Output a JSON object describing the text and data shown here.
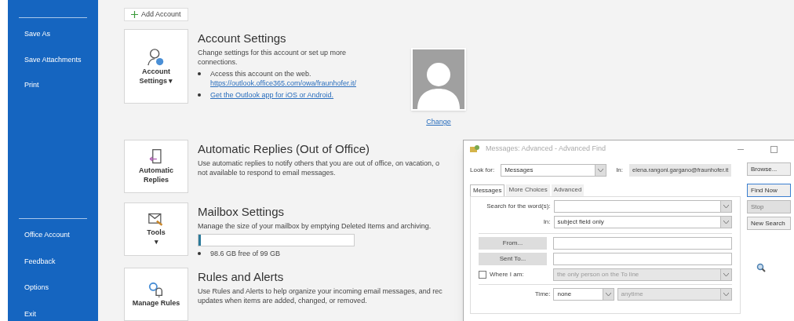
{
  "sidebar": {
    "top_items": [
      "Save As",
      "Save Attachments",
      "Print"
    ],
    "bottom_items": [
      "Office Account",
      "Feedback",
      "Options",
      "Exit"
    ]
  },
  "add_account": "Add Account",
  "sections": [
    {
      "kind": "account",
      "button": [
        "Account",
        "Settings ▾"
      ],
      "title": "Account Settings",
      "description": "Change settings for this account or set up more connections.",
      "bullets": [
        {
          "text": "Access this account on the web.",
          "link": "https://outlook.office365.com/owa/fraunhofer.it/"
        },
        {
          "link": "Get the Outlook app for iOS or Android."
        }
      ],
      "photo_link": "Change"
    },
    {
      "kind": "replies",
      "button": [
        "Automatic",
        "Replies"
      ],
      "title": "Automatic Replies (Out of Office)",
      "description": "Use automatic replies to notify others that you are out of office, on vacation, o",
      "description_2": "not available to respond to email messages."
    },
    {
      "kind": "mailbox",
      "button": [
        "Tools",
        "▾"
      ],
      "title": "Mailbox Settings",
      "description": "Manage the size of your mailbox by emptying Deleted Items and archiving.",
      "level": 0.01,
      "bullets": [
        {
          "text": "98.6 GB free of 99 GB"
        }
      ]
    },
    {
      "kind": "rules",
      "button": [
        "Manage Rules"
      ],
      "title": "Rules and Alerts",
      "description": "Use Rules and Alerts to help organize your incoming email messages, and rec",
      "description_2": "updates when items are added, changed, or removed."
    }
  ],
  "dialog": {
    "title": "Messages: Advanced - Advanced Find",
    "look_for_label": "Look for:",
    "look_for": "Messages",
    "in_label": "In:",
    "in_value": "elena.rangoni.gargano@fraunhofer.it",
    "tabs": [
      {
        "label": "Messages",
        "selected": true
      },
      {
        "label": "More Choices",
        "selected": false
      },
      {
        "label": "Advanced",
        "selected": false
      }
    ],
    "search_label": "Search for the word(s):",
    "search_in_label": "In:",
    "search_in": "subject field only",
    "from_button": "From...",
    "sent_to_button": "Sent To...",
    "where_label": "Where I am:",
    "where_checked": false,
    "where_value": "the only person on the To line",
    "time_label": "Time:",
    "time_value": "none",
    "time_range": "anytime",
    "buttons": [
      {
        "label": "Browse...",
        "disabled": false
      },
      {
        "label": "Find Now",
        "disabled": false
      },
      {
        "label": "Stop",
        "disabled": true
      },
      {
        "label": "New Search",
        "disabled": false
      }
    ]
  }
}
